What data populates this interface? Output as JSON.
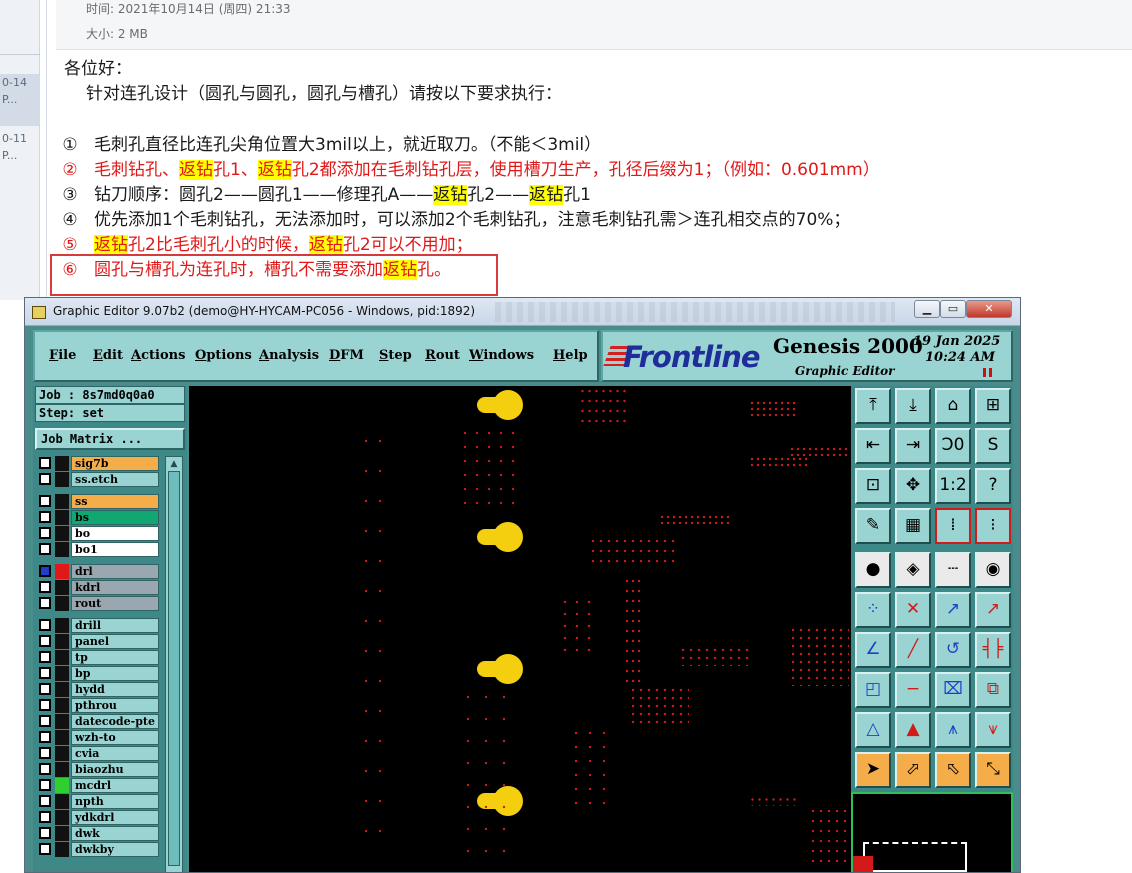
{
  "email": {
    "time_label": "时间: 2021年10月14日 (周四) 21:33",
    "size_label": "大小: 2 MB",
    "side_items": [
      {
        "date": "0-14",
        "sub": "P..."
      },
      {
        "date": "0-11",
        "sub": "P..."
      }
    ],
    "greeting": "各位好：",
    "intro": "针对连孔设计（圆孔与圆孔，圆孔与槽孔）请按以下要求执行：",
    "rules": [
      {
        "num": "①",
        "segments": [
          {
            "text": "毛刺孔直径比连孔尖角位置大3mil以上，就近取刀。（不能＜3mil）",
            "hl": false
          }
        ],
        "color": "#1a1a1a"
      },
      {
        "num": "②",
        "segments": [
          {
            "text": "毛刺钻孔、",
            "hl": false
          },
          {
            "text": "返钻",
            "hl": true
          },
          {
            "text": "孔1、",
            "hl": false
          },
          {
            "text": "返钻",
            "hl": true
          },
          {
            "text": "孔2都添加在毛刺钻孔层，使用槽刀生产，孔径后缀为1；（例如：0.601mm）",
            "hl": false
          }
        ],
        "color": "#e01818"
      },
      {
        "num": "③",
        "segments": [
          {
            "text": "钻刀顺序：圆孔2——圆孔1——修理孔A——",
            "hl": false
          },
          {
            "text": "返钻",
            "hl": true
          },
          {
            "text": "孔2——",
            "hl": false
          },
          {
            "text": "返钻",
            "hl": true
          },
          {
            "text": "孔1",
            "hl": false
          }
        ],
        "color": "#1a1a1a"
      },
      {
        "num": "④",
        "segments": [
          {
            "text": "优先添加1个毛刺钻孔，无法添加时，可以添加2个毛刺钻孔，注意毛刺钻孔需＞连孔相交点的70%；",
            "hl": false
          }
        ],
        "color": "#1a1a1a"
      },
      {
        "num": "⑤",
        "segments": [
          {
            "text": "返钻",
            "hl": true
          },
          {
            "text": "孔2比毛刺孔小的时候，",
            "hl": false
          },
          {
            "text": "返钻",
            "hl": true
          },
          {
            "text": "孔2可以不用加；",
            "hl": false
          }
        ],
        "color": "#e01818"
      },
      {
        "num": "⑥",
        "segments": [
          {
            "text": "圆孔与槽孔为连孔时，槽孔不需要添加",
            "hl": false
          },
          {
            "text": "返钻",
            "hl": true
          },
          {
            "text": "孔。",
            "hl": false
          }
        ],
        "color": "#e01818"
      }
    ]
  },
  "window": {
    "title": "Graphic Editor 9.07b2 (demo@HY-HYCAM-PC056 - Windows, pid:1892)",
    "min_glyph": "▁",
    "max_glyph": "▭",
    "close_glyph": "✕"
  },
  "menu": {
    "items": [
      {
        "label": "File",
        "key": "F",
        "rest": "ile"
      },
      {
        "label": "Edit",
        "key": "E",
        "rest": "dit"
      },
      {
        "label": "Actions",
        "key": "A",
        "rest": "ctions"
      },
      {
        "label": "Options",
        "key": "O",
        "rest": "ptions"
      },
      {
        "label": "Analysis",
        "key": "A",
        "rest": "nalysis"
      },
      {
        "label": "DFM",
        "key": "D",
        "rest": "FM"
      },
      {
        "label": "Step",
        "key": "S",
        "rest": "tep"
      },
      {
        "label": "Rout",
        "key": "R",
        "rest": "out"
      },
      {
        "label": "Windows",
        "key": "W",
        "rest": "indows"
      },
      {
        "label": "Help",
        "key": "H",
        "rest": "elp"
      }
    ]
  },
  "brand": {
    "logo": "Frontline",
    "product": "Genesis 2000",
    "subtitle": "Graphic Editor",
    "date": "19 Jan 2025",
    "time": "10:24 AM"
  },
  "job": {
    "job_label": "Job : 8s7md0q0a0",
    "step_label": "Step: set",
    "matrix_button": "Job Matrix ..."
  },
  "layers": [
    {
      "name": "sig7b",
      "color": "#f4ad48",
      "chk": "#ffffff",
      "cell": "#111111"
    },
    {
      "name": "ss.etch",
      "color": "#9ad4d2",
      "chk": "#ffffff",
      "cell": "#111111"
    },
    {
      "name": "ss",
      "color": "#f4ad48",
      "chk": "#ffffff",
      "cell": "#111111"
    },
    {
      "name": "bs",
      "color": "#12a672",
      "chk": "#ffffff",
      "cell": "#111111"
    },
    {
      "name": "bo",
      "color": "#ffffff",
      "chk": "#ffffff",
      "cell": "#111111"
    },
    {
      "name": "bo1",
      "color": "#ffffff",
      "chk": "#ffffff",
      "cell": "#111111"
    },
    {
      "name": "drl",
      "color": "#9aa6b0",
      "chk": "#1f3fc8",
      "cell": "#e01818"
    },
    {
      "name": "kdrl",
      "color": "#9aa6b0",
      "chk": "#ffffff",
      "cell": "#111111"
    },
    {
      "name": "rout",
      "color": "#9aa6b0",
      "chk": "#ffffff",
      "cell": "#111111"
    },
    {
      "name": "drill",
      "color": "#9ad4d2",
      "chk": "#ffffff",
      "cell": "#111111"
    },
    {
      "name": "panel",
      "color": "#9ad4d2",
      "chk": "#ffffff",
      "cell": "#111111"
    },
    {
      "name": "tp",
      "color": "#9ad4d2",
      "chk": "#ffffff",
      "cell": "#111111"
    },
    {
      "name": "bp",
      "color": "#9ad4d2",
      "chk": "#ffffff",
      "cell": "#111111"
    },
    {
      "name": "hydd",
      "color": "#9ad4d2",
      "chk": "#ffffff",
      "cell": "#111111"
    },
    {
      "name": "pthrou",
      "color": "#9ad4d2",
      "chk": "#ffffff",
      "cell": "#111111"
    },
    {
      "name": "datecode-pte",
      "color": "#9ad4d2",
      "chk": "#ffffff",
      "cell": "#111111"
    },
    {
      "name": "wzh-to",
      "color": "#9ad4d2",
      "chk": "#ffffff",
      "cell": "#111111"
    },
    {
      "name": "cvia",
      "color": "#9ad4d2",
      "chk": "#ffffff",
      "cell": "#111111"
    },
    {
      "name": "biaozhu",
      "color": "#9ad4d2",
      "chk": "#ffffff",
      "cell": "#111111"
    },
    {
      "name": "mcdrl",
      "color": "#9ad4d2",
      "chk": "#ffffff",
      "cell": "#2fcf2f"
    },
    {
      "name": "npth",
      "color": "#9ad4d2",
      "chk": "#ffffff",
      "cell": "#111111"
    },
    {
      "name": "ydkdrl",
      "color": "#9ad4d2",
      "chk": "#ffffff",
      "cell": "#111111"
    },
    {
      "name": "dwk",
      "color": "#9ad4d2",
      "chk": "#ffffff",
      "cell": "#111111"
    },
    {
      "name": "dwkby",
      "color": "#9ad4d2",
      "chk": "#ffffff",
      "cell": "#111111"
    }
  ],
  "tools": [
    {
      "name": "zoom-home-icon",
      "glyph": "⤒",
      "style": ""
    },
    {
      "name": "zoom-out-icon",
      "glyph": "⤓",
      "style": ""
    },
    {
      "name": "home-icon",
      "glyph": "⌂",
      "style": ""
    },
    {
      "name": "window-icon",
      "glyph": "⊞",
      "style": ""
    },
    {
      "name": "pan-left-icon",
      "glyph": "⇤",
      "style": ""
    },
    {
      "name": "pan-right-icon",
      "glyph": "⇥",
      "style": ""
    },
    {
      "name": "mirror-icon",
      "glyph": "Ↄ0",
      "style": ""
    },
    {
      "name": "snap-icon",
      "glyph": "S",
      "style": ""
    },
    {
      "name": "fit-icon",
      "glyph": "⊡",
      "style": ""
    },
    {
      "name": "center-icon",
      "glyph": "✥",
      "style": ""
    },
    {
      "name": "scale-icon",
      "glyph": "1:2",
      "style": ""
    },
    {
      "name": "help-icon",
      "glyph": "?",
      "style": ""
    },
    {
      "name": "measure-icon",
      "glyph": "✎",
      "style": ""
    },
    {
      "name": "grid-icon",
      "glyph": "▦",
      "style": ""
    },
    {
      "name": "layer-display-icon",
      "glyph": "⁞",
      "style": "r"
    },
    {
      "name": "layer-link-icon",
      "glyph": "⁝",
      "style": "r"
    },
    {
      "name": "pad-icon",
      "glyph": "●",
      "style": "w"
    },
    {
      "name": "rotate-icon",
      "glyph": "◈",
      "style": "w"
    },
    {
      "name": "ruler-icon",
      "glyph": "┄",
      "style": "w"
    },
    {
      "name": "select-icon",
      "glyph": "◉",
      "style": "w"
    },
    {
      "name": "net-icon",
      "glyph": "⁘",
      "style": ""
    },
    {
      "name": "cross-icon",
      "glyph": "✕",
      "style": ""
    },
    {
      "name": "connect-icon",
      "glyph": "↗",
      "style": ""
    },
    {
      "name": "link-icon",
      "glyph": "↗",
      "style": ""
    },
    {
      "name": "line-icon",
      "glyph": "∠",
      "style": ""
    },
    {
      "name": "slash-icon",
      "glyph": "╱",
      "style": ""
    },
    {
      "name": "undo-icon",
      "glyph": "↺",
      "style": ""
    },
    {
      "name": "split-icon",
      "glyph": "╡╞",
      "style": ""
    },
    {
      "name": "add-pad-icon",
      "glyph": "◰",
      "style": ""
    },
    {
      "name": "minus-icon",
      "glyph": "−",
      "style": ""
    },
    {
      "name": "frame-icon",
      "glyph": "⌧",
      "style": ""
    },
    {
      "name": "group-icon",
      "glyph": "⧉",
      "style": ""
    },
    {
      "name": "triangle-icon",
      "glyph": "△",
      "style": ""
    },
    {
      "name": "triangle-up-icon",
      "glyph": "▲",
      "style": ""
    },
    {
      "name": "arch-icon",
      "glyph": "⩚",
      "style": ""
    },
    {
      "name": "arch-cross-icon",
      "glyph": "⩛",
      "style": ""
    },
    {
      "name": "pointer-icon",
      "glyph": "➤",
      "style": "o"
    },
    {
      "name": "pointer-box-icon",
      "glyph": "⬀",
      "style": "o"
    },
    {
      "name": "pointer-alt-icon",
      "glyph": "⬁",
      "style": "o"
    },
    {
      "name": "route-icon",
      "glyph": "⤡",
      "style": "o"
    }
  ]
}
